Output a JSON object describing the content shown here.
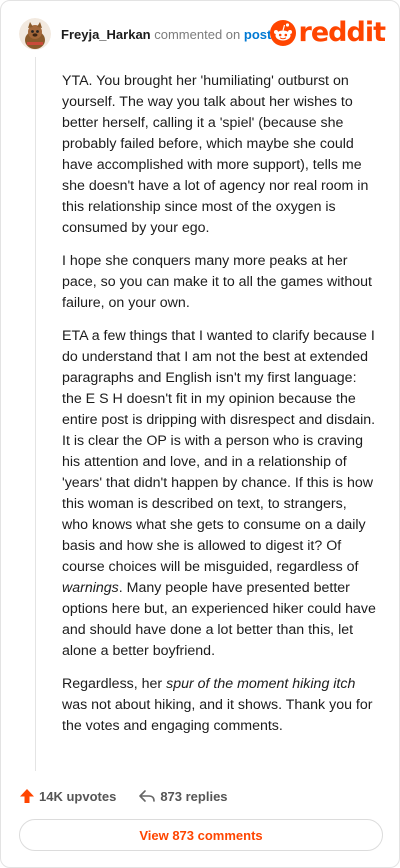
{
  "header": {
    "username": "Freyja_Harkan",
    "commented_text": "commented on",
    "post_link": "post",
    "logo_text": "reddit"
  },
  "comment": {
    "p1": "YTA. You brought her 'humiliating' outburst on yourself. The way you talk about her wishes to better herself, calling it a 'spiel' (because she probably failed before, which maybe she could have accomplished with more support), tells me she doesn't have a lot of agency nor real room in this relationship since most of the oxygen is consumed by your ego.",
    "p2": "I hope she conquers many more peaks at her pace, so you can make it to all the games without failure, on your own.",
    "p3_a": "ETA a few things that I wanted to clarify because I do understand that I am not the best at extended paragraphs and English isn't my first language: the E S H doesn't fit in my opinion because the entire post is dripping with disrespect and disdain. It is clear the OP is with a person who is craving his attention and love, and in a relationship of 'years' that didn't happen by chance. If this is how this woman is described on text, to strangers, who knows what she gets to consume on a daily basis and how she is allowed to digest it? Of course choices will be misguided, regardless of ",
    "p3_em": "warnings",
    "p3_b": ". Many people have presented better options here but, an experienced hiker could have and should have done a lot better than this, let alone a better boyfriend.",
    "p4_a": "Regardless, her ",
    "p4_em": "spur of the moment hiking itch",
    "p4_b": " was not about hiking, and it shows. Thank you for the votes and engaging comments."
  },
  "actions": {
    "upvotes": "14K upvotes",
    "replies": "873 replies"
  },
  "view_button": "View 873 comments",
  "colors": {
    "brand": "#ff4500",
    "link": "#0079d3",
    "upvote": "#ff4500"
  }
}
